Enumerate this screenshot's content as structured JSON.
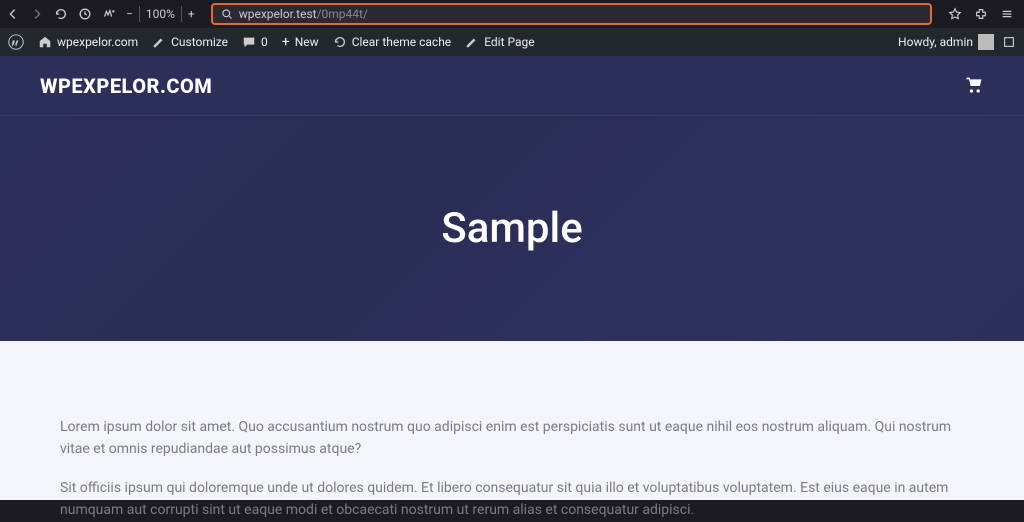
{
  "browser": {
    "zoom": "100%",
    "url_host": "wpexpelor.test",
    "url_path": "/0mp44t/"
  },
  "adminbar": {
    "site_name": "wpexpelor.com",
    "customize": "Customize",
    "comments": "0",
    "new": "New",
    "clear_cache": "Clear theme cache",
    "edit_page": "Edit Page",
    "howdy": "Howdy, admin"
  },
  "site": {
    "title": "WPEXPELOR.COM"
  },
  "hero": {
    "title": "Sample"
  },
  "content": {
    "p1": "Lorem ipsum dolor sit amet. Quo accusantium nostrum quo adipisci enim est perspiciatis sunt ut eaque nihil eos nostrum aliquam. Qui nostrum vitae et omnis repudiandae aut possimus atque?",
    "p2": "Sit officiis ipsum qui doloremque unde ut dolores quidem. Et libero consequatur sit quia illo et voluptatibus voluptatem. Est eius eaque in autem numquam aut corrupti sint ut eaque modi et obcaecati nostrum ut rerum alias et consequatur adipisci."
  }
}
